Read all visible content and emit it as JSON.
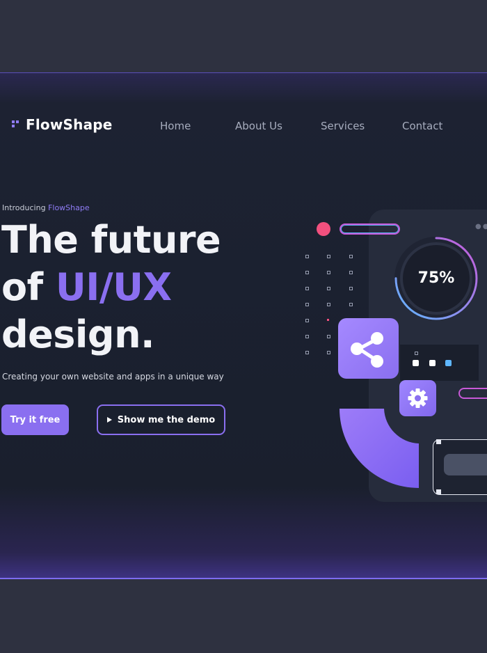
{
  "nav": {
    "logo_text": "FlowShape",
    "items": [
      {
        "label": "Home"
      },
      {
        "label": "About Us"
      },
      {
        "label": "Services"
      },
      {
        "label": "Contact"
      }
    ]
  },
  "hero": {
    "intro_prefix": "Introducing",
    "intro_brand": "FlowShape",
    "headline_line1": "The future",
    "headline_of": "of",
    "headline_accent": "UI/UX",
    "headline_line3": "design.",
    "subtext": "Creating your own website and apps in a unique way",
    "primary_button": "Try it free",
    "secondary_button": "Show me the demo"
  },
  "illustration": {
    "progress_label": "75%",
    "progress_value": 0.75
  },
  "colors": {
    "accent": "#8a6ff0",
    "background": "#1b2130",
    "pink": "#f2507e",
    "cyan": "#5fb7ff",
    "magenta": "#c859d8"
  },
  "icons": [
    "play-icon",
    "share-icon",
    "gear-icon",
    "logo-mark-icon"
  ]
}
